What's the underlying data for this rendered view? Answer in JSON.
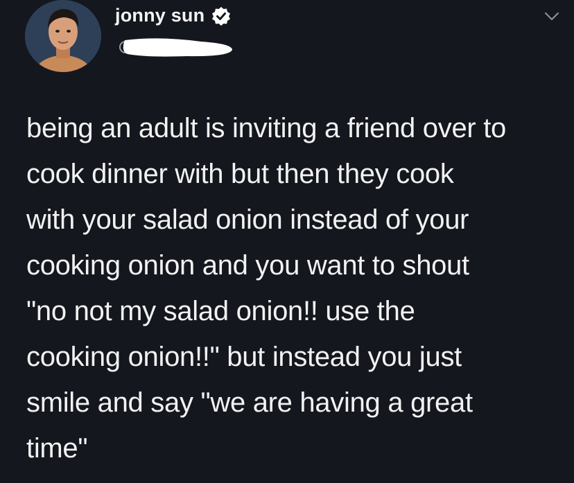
{
  "tweet": {
    "author": {
      "display_name": "jonny sun",
      "verified": true,
      "avatar_icon": "user-avatar",
      "handle_redacted": true
    },
    "menu_icon": "chevron-down-icon",
    "text": "being an adult is inviting a friend over to\ncook dinner with but then they cook\nwith your salad onion instead of your\ncooking onion and you want to shout\n\"no not my salad onion!! use the\ncooking onion!!\" but instead you just\nsmile and say \"we are having a great\ntime\"",
    "colors": {
      "background": "#15171f",
      "text": "#f2f2f2",
      "verified_badge": "#ffffff",
      "redaction": "#ffffff"
    }
  }
}
